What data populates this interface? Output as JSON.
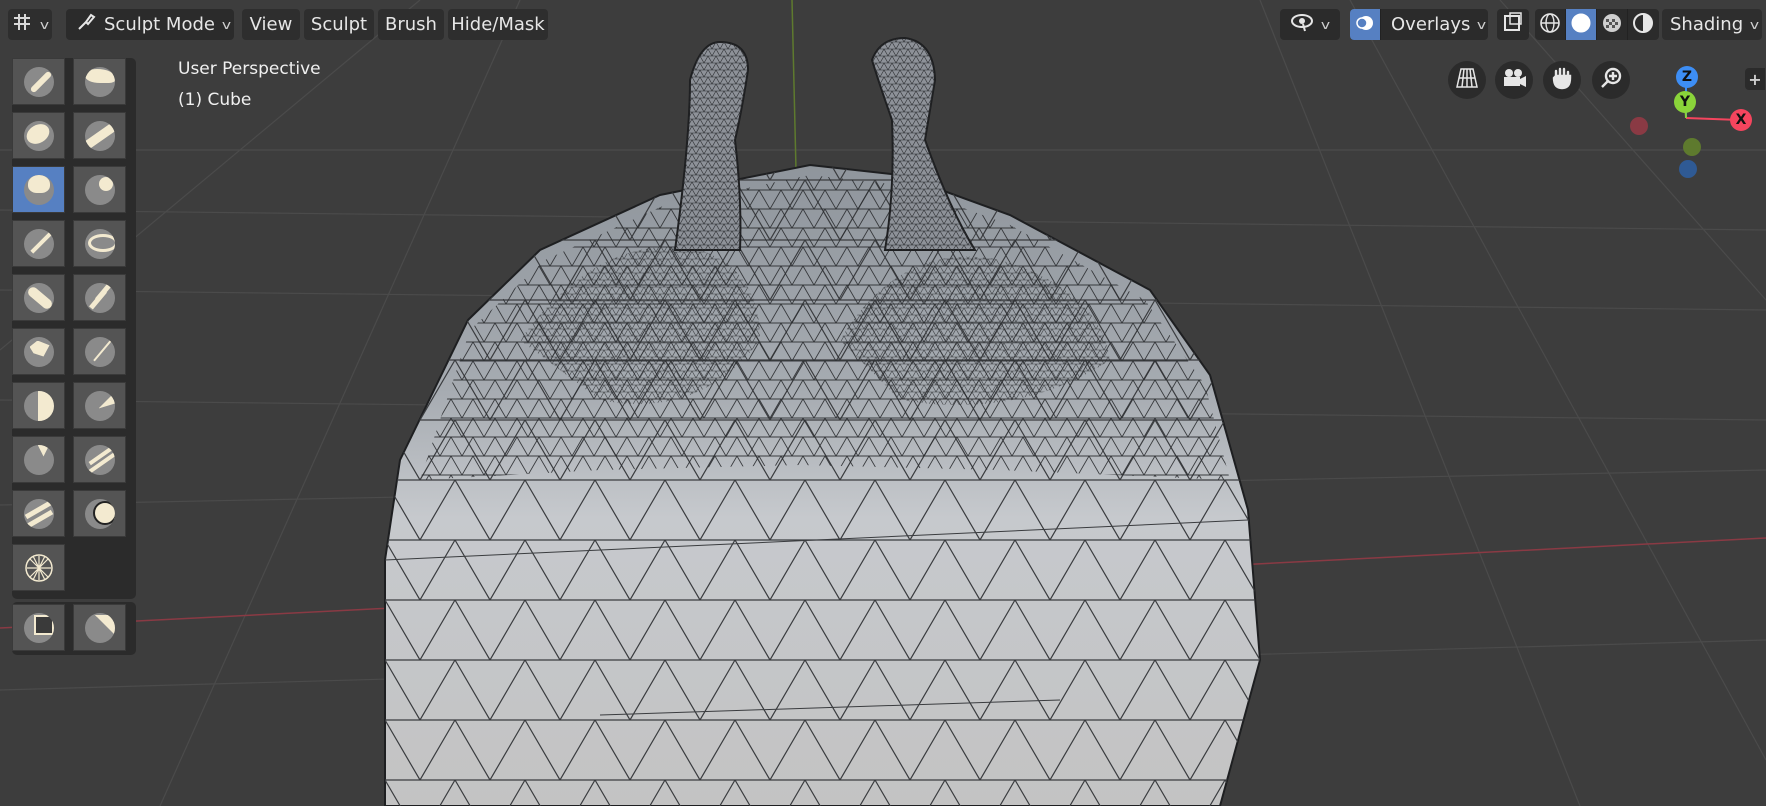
{
  "header": {
    "editor_type_icon": "transform-grid-icon",
    "mode": {
      "label": "Sculpt Mode",
      "icon": "sculpt-brush-icon"
    },
    "menus": [
      "View",
      "Sculpt",
      "Brush",
      "Hide/Mask"
    ],
    "visibility_icon": "eye-select-icon",
    "overlays_label": "Overlays",
    "xray_icon": "xray-toggle-icon",
    "shading_modes": [
      "wireframe",
      "solid",
      "material-preview",
      "rendered"
    ],
    "shading_active": "solid",
    "shading_label": "Shading"
  },
  "viewport": {
    "view_name": "User Perspective",
    "object_name": "(1) Cube"
  },
  "navigation": {
    "buttons": [
      "perspective-grid-icon",
      "camera-icon",
      "hand-pan-icon",
      "zoom-icon"
    ],
    "gizmo": {
      "x_label": "X",
      "y_label": "Y",
      "z_label": "Z",
      "colors": {
        "x": "#f5455e",
        "y": "#8ad43a",
        "z": "#3d8ef5"
      }
    }
  },
  "toolbar": {
    "brushes": [
      "draw-brush-icon",
      "draw-sharp-brush-icon",
      "clay-brush-icon",
      "clay-strips-brush-icon",
      "clay-thumb-brush-icon",
      "layer-brush-icon",
      "inflate-brush-icon",
      "blob-brush-icon",
      "crease-brush-icon",
      "smooth-brush-icon",
      "flatten-brush-icon",
      "fill-brush-icon",
      "scrape-brush-icon",
      "multiplane-scrape-brush-icon",
      "pinch-brush-icon",
      "grab-brush-icon",
      "snake-hook-brush-icon",
      "thumb-brush-icon",
      "pose-brush-icon",
      "nudge-brush-icon",
      "rotate-brush-icon"
    ],
    "active_index": 4,
    "extra_tools": [
      "mask-box-icon",
      "mask-lasso-icon"
    ]
  },
  "colors": {
    "accent": "#5680c2",
    "background": "#3d3d3d",
    "panel": "#2b2b2b"
  }
}
